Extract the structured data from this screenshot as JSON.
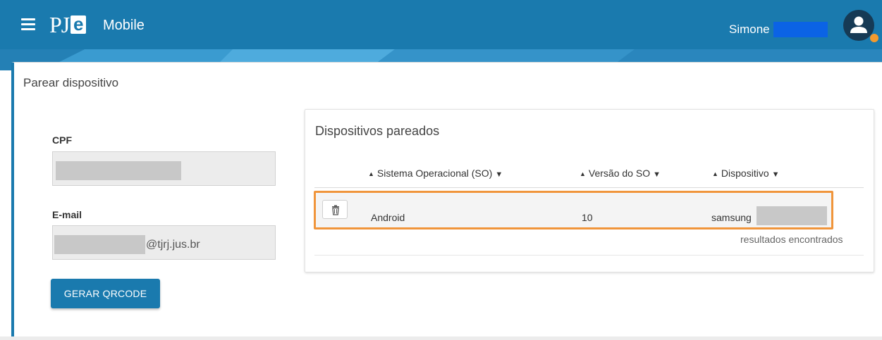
{
  "header": {
    "logo_pj": "PJ",
    "logo_e": "e",
    "app_name": "Mobile",
    "user_name": "Simone"
  },
  "page": {
    "title": "Parear dispositivo"
  },
  "form": {
    "cpf_label": "CPF",
    "email_label": "E-mail",
    "email_suffix": "@tjrj.jus.br",
    "generate_button": "GERAR QRCODE"
  },
  "devices": {
    "title": "Dispositivos pareados",
    "columns": [
      {
        "label": "Sistema Operacional (SO)"
      },
      {
        "label": "Versão do SO"
      },
      {
        "label": "Dispositivo"
      }
    ],
    "rows": [
      {
        "so": "Android",
        "version": "10",
        "device": "samsung"
      }
    ],
    "results_text": "resultados encontrados"
  },
  "colors": {
    "header": "#1a7aae",
    "highlight": "#f0953b",
    "redaction_blue": "#0b63e5"
  },
  "icons": {
    "menu": "hamburger-icon",
    "avatar": "user-icon",
    "delete": "trash-icon",
    "sort_up": "caret-up-icon",
    "sort_down": "caret-down-icon"
  }
}
